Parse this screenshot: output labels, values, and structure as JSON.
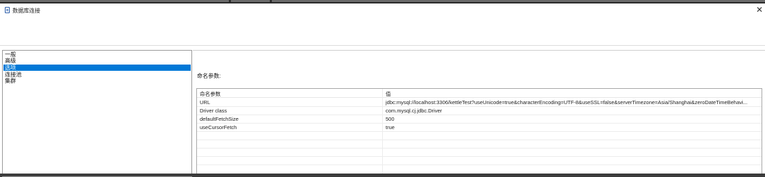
{
  "window": {
    "title": "数据库连接",
    "title_icon": "database-icon",
    "close_icon": "close-icon",
    "close_glyph": "✕"
  },
  "sidebar": {
    "items": [
      {
        "label": "一般",
        "selected": false
      },
      {
        "label": "高级",
        "selected": false
      },
      {
        "label": "选项",
        "selected": true
      },
      {
        "label": "连接池",
        "selected": false
      },
      {
        "label": "集群",
        "selected": false
      }
    ]
  },
  "options": {
    "section_label": "命名参数:",
    "table": {
      "columns": [
        "命名参数",
        "值"
      ],
      "rows": [
        {
          "name": "URL",
          "value": "jdbc:mysql://localhost:3306/kettleTest?useUnicode=true&characterEncoding=UTF-8&useSSL=false&serverTimezone=Asia/Shanghai&zeroDateTimeBehavi..."
        },
        {
          "name": "Driver class",
          "value": "com.mysql.cj.jdbc.Driver"
        },
        {
          "name": "defaultFetchSize",
          "value": "500"
        },
        {
          "name": "useCursorFetch",
          "value": "true"
        },
        {
          "name": "",
          "value": ""
        },
        {
          "name": "",
          "value": ""
        },
        {
          "name": "",
          "value": ""
        },
        {
          "name": "",
          "value": ""
        }
      ]
    }
  },
  "colors": {
    "selection": "#0078d7",
    "border": "#9a9a9a"
  }
}
